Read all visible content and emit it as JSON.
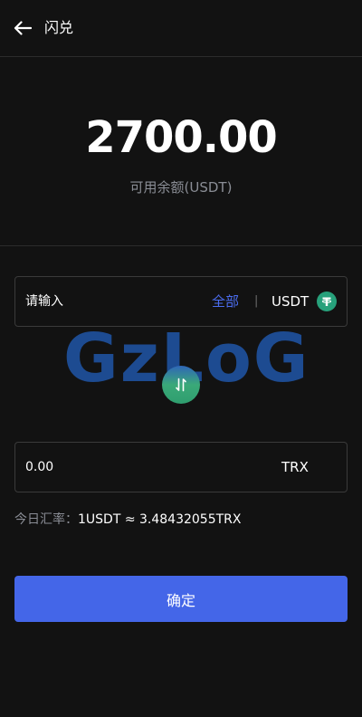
{
  "header": {
    "title": "闪兑",
    "back_icon": "arrow-left-icon"
  },
  "balance": {
    "amount": "2700.00",
    "label": "可用余额(USDT)"
  },
  "from": {
    "placeholder": "请输入",
    "all_label": "全部",
    "separator": "|",
    "currency": "USDT",
    "currency_icon": "tether-icon",
    "currency_icon_color": "#27a17b"
  },
  "swap": {
    "icon": "swap-arrows-icon"
  },
  "watermark": {
    "text": "GzLoG"
  },
  "to": {
    "value": "0.00",
    "currency": "TRX"
  },
  "rate": {
    "label": "今日汇率：",
    "value": "1USDT ≈ 3.48432055TRX"
  },
  "confirm": {
    "label": "确定"
  },
  "colors": {
    "background": "#121212",
    "accent": "#4466e8",
    "link": "#4b6df0",
    "muted": "#8a8d95"
  }
}
